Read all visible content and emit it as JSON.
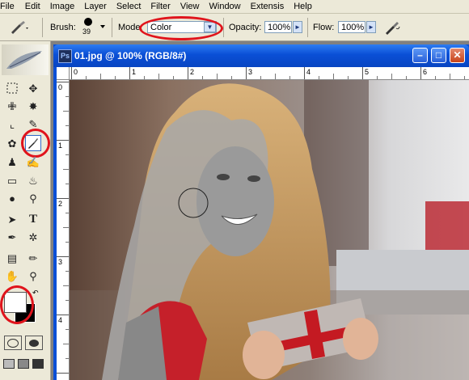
{
  "menu": [
    "File",
    "Edit",
    "Image",
    "Layer",
    "Select",
    "Filter",
    "View",
    "Window",
    "Extensis",
    "Help"
  ],
  "options": {
    "brush_label": "Brush:",
    "brush_size": "39",
    "mode_label": "Mode:",
    "mode_value": "Color",
    "opacity_label": "Opacity:",
    "opacity_value": "100%",
    "flow_label": "Flow:",
    "flow_value": "100%"
  },
  "document": {
    "title": "01.jpg @ 100% (RGB/8#)"
  },
  "rulers": {
    "top": [
      "0",
      "1",
      "2",
      "3",
      "4",
      "5",
      "6"
    ],
    "left": [
      "0",
      "1",
      "2",
      "3",
      "4"
    ]
  },
  "colors": {
    "highlight": "#e0141c",
    "titlebar": "#0a4fd6",
    "chrome": "#ece9d8"
  }
}
